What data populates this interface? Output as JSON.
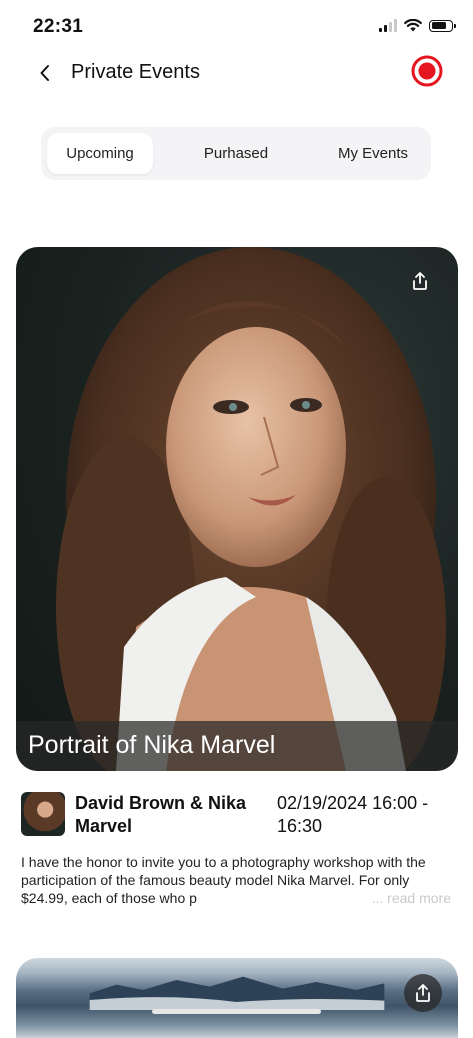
{
  "status": {
    "time": "22:31",
    "battery_level": 0.8
  },
  "nav": {
    "title": "Private Events",
    "back_icon": "chevron-left-icon",
    "record_icon": "record-icon",
    "record_color": "#e5161f"
  },
  "tabs": [
    {
      "label": "Upcoming",
      "active": true
    },
    {
      "label": "Purhased",
      "active": false
    },
    {
      "label": "My Events",
      "active": false
    }
  ],
  "event": {
    "title": "Portrait of Nika Marvel",
    "host": "David Brown & Nika Marvel",
    "date": "02/19/2024 16:00 - 16:30",
    "description": "I have the honor to invite you to a photography workshop with the participation of the famous beauty model Nika Marvel. For only $24.99, each of those who p",
    "read_more": "... read more",
    "share_icon": "share-icon"
  },
  "next_event": {
    "share_icon": "share-icon"
  }
}
